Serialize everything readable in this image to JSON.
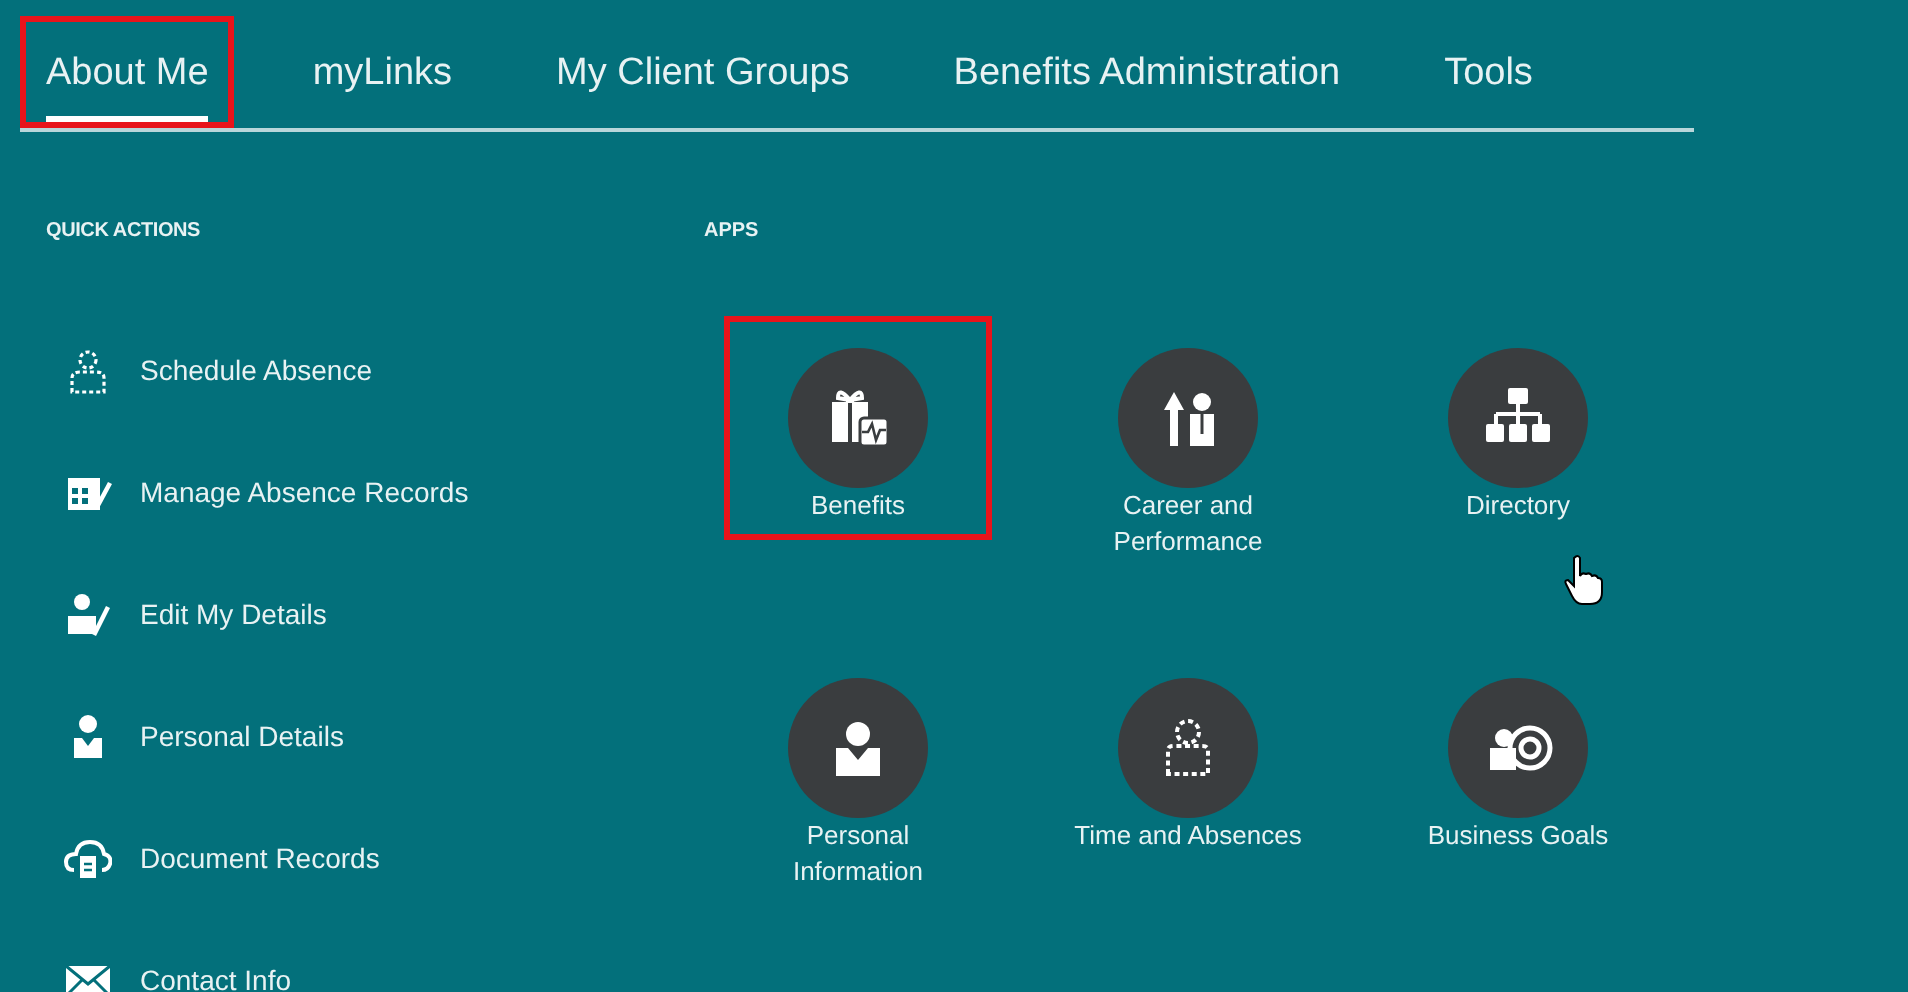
{
  "tabs": [
    {
      "label": "About Me",
      "selected": true,
      "highlighted": true
    },
    {
      "label": "myLinks",
      "selected": false,
      "highlighted": false
    },
    {
      "label": "My Client Groups",
      "selected": false,
      "highlighted": false
    },
    {
      "label": "Benefits Administration",
      "selected": false,
      "highlighted": false
    },
    {
      "label": "Tools",
      "selected": false,
      "highlighted": false
    }
  ],
  "quick_actions": {
    "title": "QUICK ACTIONS",
    "items": [
      {
        "label": "Schedule Absence"
      },
      {
        "label": "Manage Absence Records"
      },
      {
        "label": "Edit My Details"
      },
      {
        "label": "Personal Details"
      },
      {
        "label": "Document Records"
      },
      {
        "label": "Contact Info"
      }
    ]
  },
  "apps": {
    "title": "APPS",
    "items": [
      {
        "label": "Benefits",
        "highlighted": true
      },
      {
        "label": "Career and Performance",
        "highlighted": false
      },
      {
        "label": "Directory",
        "highlighted": false
      },
      {
        "label": "Personal Information",
        "highlighted": false
      },
      {
        "label": "Time and Absences",
        "highlighted": false
      },
      {
        "label": "Business Goals",
        "highlighted": false
      }
    ]
  }
}
